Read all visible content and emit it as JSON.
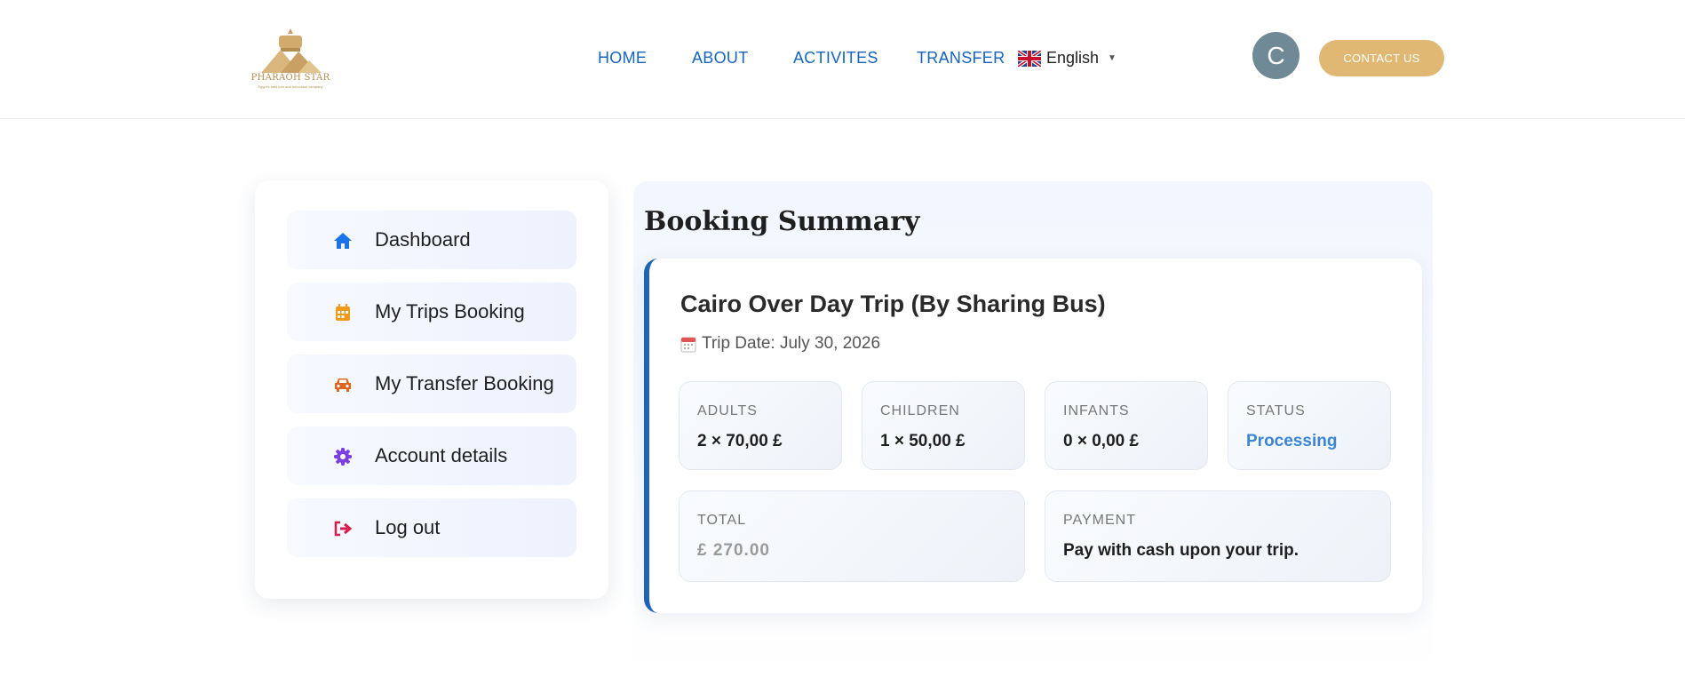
{
  "header": {
    "logo_text": "PHARAOH STAR",
    "logo_tagline": "Egypt's best tour and excursion company",
    "nav": [
      {
        "label": "HOME"
      },
      {
        "label": "ABOUT"
      },
      {
        "label": "ACTIVITES"
      },
      {
        "label": "TRANSFER"
      }
    ],
    "language": "English",
    "avatar_initial": "C",
    "contact_label": "CONTACT US"
  },
  "sidebar": {
    "items": [
      {
        "label": "Dashboard",
        "icon": "home-icon",
        "color": "#1a73e8"
      },
      {
        "label": "My Trips Booking",
        "icon": "calendar-icon",
        "color": "#f09a1a"
      },
      {
        "label": "My Transfer Booking",
        "icon": "car-icon",
        "color": "#e0661f"
      },
      {
        "label": "Account details",
        "icon": "gear-icon",
        "color": "#7b3fe4"
      },
      {
        "label": "Log out",
        "icon": "logout-icon",
        "color": "#d81b4a"
      }
    ]
  },
  "booking": {
    "title": "Booking Summary",
    "trip_name": "Cairo Over Day Trip (By Sharing Bus)",
    "trip_date": "Trip Date: July 30, 2026",
    "adults_label": "ADULTS",
    "adults_value": "2 × 70,00 £",
    "children_label": "CHILDREN",
    "children_value": "1 × 50,00 £",
    "infants_label": "INFANTS",
    "infants_value": "0 × 0,00 £",
    "status_label": "STATUS",
    "status_value": "Processing",
    "total_label": "TOTAL",
    "total_value": "£ 270.00",
    "payment_label": "PAYMENT",
    "payment_value": "Pay with cash upon your trip."
  },
  "colors": {
    "accent_blue": "#1e63b8",
    "nav_blue": "#1565c0",
    "contact_gold": "#e0b873",
    "status_blue": "#3a86d4"
  }
}
